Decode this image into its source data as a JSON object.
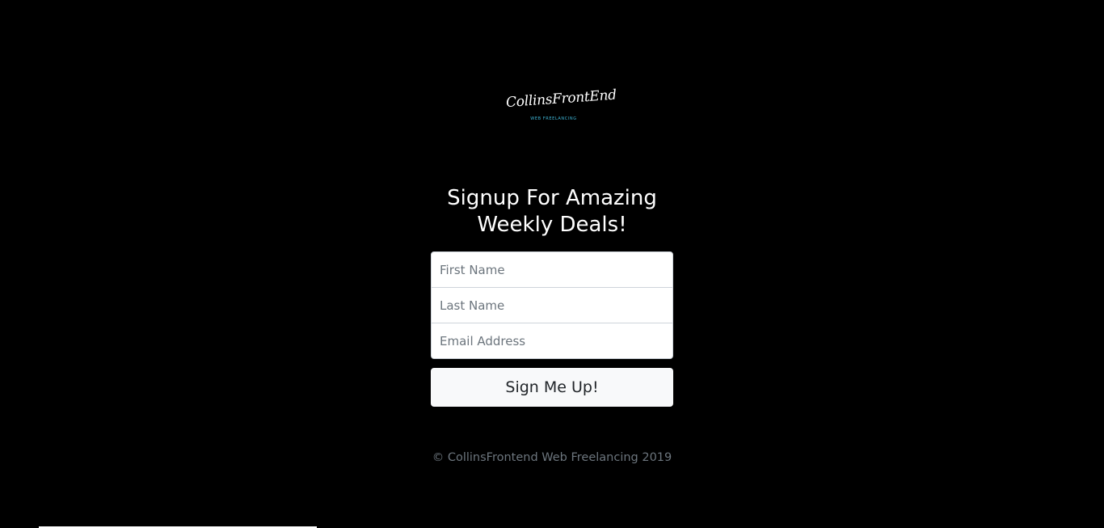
{
  "logo": {
    "wordmark": "CollinsFrontEnd",
    "tagline": "WEB FREELANCING"
  },
  "signup": {
    "heading": "Signup For Amazing Weekly Deals!",
    "first_name_placeholder": "First Name",
    "last_name_placeholder": "Last Name",
    "email_placeholder": "Email Address",
    "submit_label": "Sign Me Up!"
  },
  "footer": {
    "copyright": "© CollinsFrontend Web Freelancing 2019"
  },
  "colors": {
    "background": "#000000",
    "text": "#ffffff",
    "muted_text": "#6c757d",
    "button": "#f8f9fa",
    "logo_accent": "#3fb7d8"
  }
}
